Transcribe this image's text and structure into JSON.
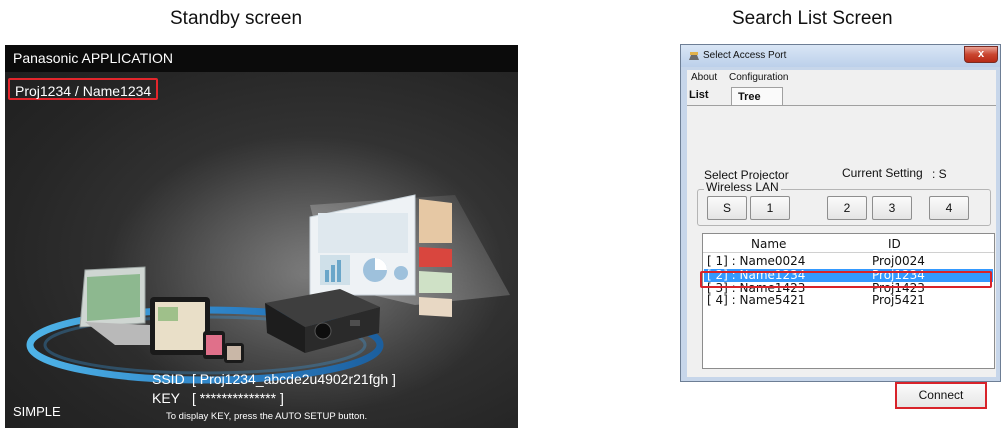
{
  "captions": {
    "standby": "Standby screen",
    "search": "Search List Screen"
  },
  "standby": {
    "header": "Panasonic APPLICATION",
    "projector_name": "Proj1234 / Name1234",
    "ssid_label": "SSID",
    "ssid_value": "[ Proj1234_abcde2u4902r21fgh ]",
    "key_label": "KEY",
    "key_value": "[ ************** ]",
    "key_hint": "To display KEY, press the AUTO SETUP button.",
    "mode": "SIMPLE"
  },
  "window": {
    "title": "Select Access Port",
    "close_glyph": "x",
    "menu": [
      "About",
      "Configuration"
    ],
    "tabs": [
      "List",
      "Tree"
    ],
    "select_projector_label": "Select Projector",
    "current_setting_label": "Current Setting",
    "current_setting_value": ": S",
    "group_title": "Wireless LAN",
    "port_buttons": [
      "S",
      "1",
      "2",
      "3",
      "4"
    ],
    "columns": [
      "Name",
      "ID"
    ],
    "rows": [
      {
        "name": "[ 1] : Name0024",
        "id": "Proj0024"
      },
      {
        "name": "[ 2] : Name1234",
        "id": "Proj1234",
        "selected": true
      },
      {
        "name": "[ 3] : Name1423",
        "id": "Proj1423"
      },
      {
        "name": "[ 4] : Name5421",
        "id": "Proj5421"
      }
    ],
    "connect_label": "Connect"
  },
  "colors": {
    "highlight": "#d8232a",
    "selection": "#3399ff",
    "title_bar": "#bcd0ea",
    "standby_bg": "#2a2a2a"
  }
}
